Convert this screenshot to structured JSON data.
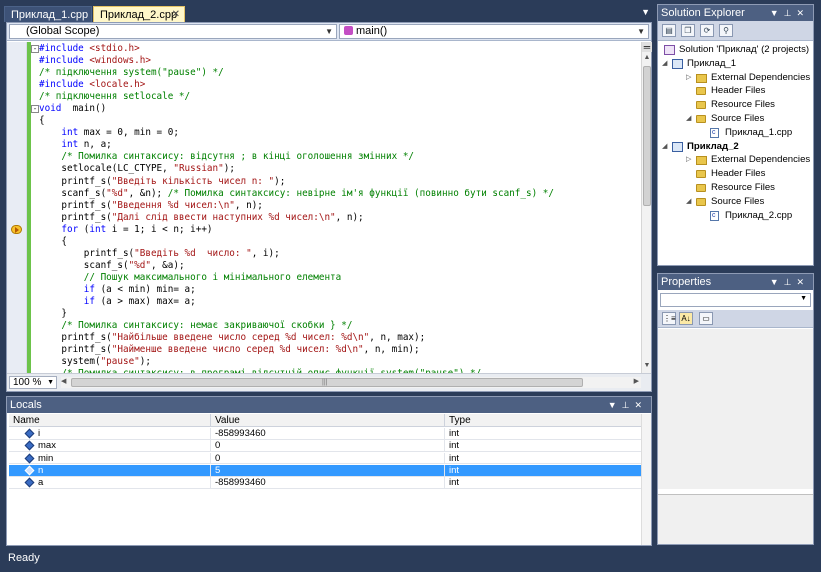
{
  "tabs": [
    {
      "label": "Приклад_1.cpp",
      "active": false
    },
    {
      "label": "Приклад_2.cpp",
      "active": true
    }
  ],
  "editor": {
    "scope_combo": "(Global Scope)",
    "member_combo": "main()",
    "zoom": "100 %",
    "code": [
      {
        "segs": [
          [
            "pp",
            "#include "
          ],
          [
            "st",
            "<stdio.h>"
          ]
        ],
        "fold": "−"
      },
      {
        "segs": [
          [
            "pp",
            "#include "
          ],
          [
            "st",
            "<windows.h>"
          ]
        ]
      },
      {
        "segs": [
          [
            "cm",
            "/* підключення system(\"pause\") */"
          ]
        ]
      },
      {
        "segs": [
          [
            "pp",
            "#include "
          ],
          [
            "st",
            "<locale.h>"
          ]
        ]
      },
      {
        "segs": [
          [
            "cm",
            "/* підключення setlocale */"
          ]
        ]
      },
      {
        "segs": [
          [
            "kw",
            "void"
          ],
          [
            "",
            "  main()"
          ]
        ],
        "fold": "−"
      },
      {
        "segs": [
          [
            "",
            "{"
          ]
        ]
      },
      {
        "segs": [
          [
            "",
            "    "
          ],
          [
            "kw",
            "int"
          ],
          [
            "",
            " max = 0, min = 0;"
          ]
        ]
      },
      {
        "segs": [
          [
            "",
            "    "
          ],
          [
            "kw",
            "int"
          ],
          [
            "",
            " n, a;"
          ]
        ]
      },
      {
        "segs": [
          [
            "",
            "    "
          ],
          [
            "cm",
            "/* Помилка синтаксису: відсутня ; в кінці оголошення змінних */"
          ]
        ]
      },
      {
        "segs": [
          [
            "",
            "    setlocale(LC_CTYPE, "
          ],
          [
            "st",
            "\"Russian\""
          ],
          [
            "",
            ");"
          ]
        ]
      },
      {
        "segs": [
          [
            "",
            "    printf_s("
          ],
          [
            "st",
            "\"Введіть кількість чисел n: \""
          ],
          [
            "",
            ");"
          ]
        ]
      },
      {
        "segs": [
          [
            "",
            "    scanf_s("
          ],
          [
            "st",
            "\"%d\""
          ],
          [
            "",
            ", &n); "
          ],
          [
            "cm",
            "/* Помилка синтаксису: невірне ім'я функції (повинно бути scanf_s) */"
          ]
        ]
      },
      {
        "segs": [
          [
            "",
            "    printf_s("
          ],
          [
            "st",
            "\"Введення %d чисел:\\n\""
          ],
          [
            "",
            ", n);"
          ]
        ]
      },
      {
        "segs": [
          [
            "",
            "    printf_s("
          ],
          [
            "st",
            "\"Далі слід ввести наступних %d чисел:\\n\""
          ],
          [
            "",
            ", n);"
          ]
        ]
      },
      {
        "segs": [
          [
            "",
            "    "
          ],
          [
            "kw",
            "for"
          ],
          [
            "",
            " ("
          ],
          [
            "kw",
            "int"
          ],
          [
            "",
            " i = 1; i < n; i++)"
          ]
        ],
        "breakpoint": true
      },
      {
        "segs": [
          [
            "",
            "    {"
          ]
        ]
      },
      {
        "segs": [
          [
            "",
            "        printf_s("
          ],
          [
            "st",
            "\"Введіть %d  число: \""
          ],
          [
            "",
            ", i);"
          ]
        ]
      },
      {
        "segs": [
          [
            "",
            "        scanf_s("
          ],
          [
            "st",
            "\"%d\""
          ],
          [
            "",
            ", &a);"
          ]
        ]
      },
      {
        "segs": [
          [
            "",
            "        "
          ],
          [
            "cm",
            "// Пошук максимального і мінімального елемента"
          ]
        ]
      },
      {
        "segs": [
          [
            "",
            "        "
          ],
          [
            "kw",
            "if"
          ],
          [
            "",
            " (a < min) min= a;"
          ]
        ]
      },
      {
        "segs": [
          [
            "",
            "        "
          ],
          [
            "kw",
            "if"
          ],
          [
            "",
            " (a > max) max= a;"
          ]
        ]
      },
      {
        "segs": [
          [
            "",
            "    }"
          ]
        ]
      },
      {
        "segs": [
          [
            "",
            "    "
          ],
          [
            "cm",
            "/* Помилка синтаксису: немає закриваючої скобки } */"
          ]
        ]
      },
      {
        "segs": [
          [
            "",
            "    printf_s("
          ],
          [
            "st",
            "\"Найбільше введене число серед %d чисел: %d\\n\""
          ],
          [
            "",
            ", n, max);"
          ]
        ]
      },
      {
        "segs": [
          [
            "",
            "    printf_s("
          ],
          [
            "st",
            "\"Найменше введене число серед %d чисел: %d\\n\""
          ],
          [
            "",
            ", n, min);"
          ]
        ]
      },
      {
        "segs": [
          [
            "",
            "    system("
          ],
          [
            "st",
            "\"pause\""
          ],
          [
            "",
            ");"
          ]
        ]
      },
      {
        "segs": [
          [
            "",
            "    "
          ],
          [
            "cm",
            "/* Помилка синтаксису: в програмі відсутній опис функції system(\"pause\") */"
          ]
        ]
      }
    ]
  },
  "solution_explorer": {
    "title": "Solution Explorer",
    "tree": [
      {
        "label": "Solution 'Приклад' (2 projects)",
        "level": 0,
        "icon": "sol",
        "tw": ""
      },
      {
        "label": "Приклад_1",
        "level": 1,
        "icon": "proj",
        "tw": "◢"
      },
      {
        "label": "External Dependencies",
        "level": 2,
        "icon": "deps",
        "tw": "▷"
      },
      {
        "label": "Header Files",
        "level": 2,
        "icon": "folder",
        "tw": ""
      },
      {
        "label": "Resource Files",
        "level": 2,
        "icon": "folder",
        "tw": ""
      },
      {
        "label": "Source Files",
        "level": 2,
        "icon": "folder",
        "tw": "◢"
      },
      {
        "label": "Приклад_1.cpp",
        "level": 3,
        "icon": "file",
        "tw": ""
      },
      {
        "label": "Приклад_2",
        "level": 1,
        "icon": "proj",
        "tw": "◢",
        "bold": true
      },
      {
        "label": "External Dependencies",
        "level": 2,
        "icon": "deps",
        "tw": "▷"
      },
      {
        "label": "Header Files",
        "level": 2,
        "icon": "folder",
        "tw": ""
      },
      {
        "label": "Resource Files",
        "level": 2,
        "icon": "folder",
        "tw": ""
      },
      {
        "label": "Source Files",
        "level": 2,
        "icon": "folder",
        "tw": "◢"
      },
      {
        "label": "Приклад_2.cpp",
        "level": 3,
        "icon": "file",
        "tw": ""
      }
    ]
  },
  "properties": {
    "title": "Properties"
  },
  "locals": {
    "title": "Locals",
    "columns": [
      "Name",
      "Value",
      "Type"
    ],
    "rows": [
      {
        "name": "i",
        "value": "-858993460",
        "type": "int",
        "selected": false
      },
      {
        "name": "max",
        "value": "0",
        "type": "int",
        "selected": false
      },
      {
        "name": "min",
        "value": "0",
        "type": "int",
        "selected": false
      },
      {
        "name": "n",
        "value": "5",
        "type": "int",
        "selected": true
      },
      {
        "name": "a",
        "value": "-858993460",
        "type": "int",
        "selected": false
      }
    ]
  },
  "status": {
    "text": "Ready"
  }
}
